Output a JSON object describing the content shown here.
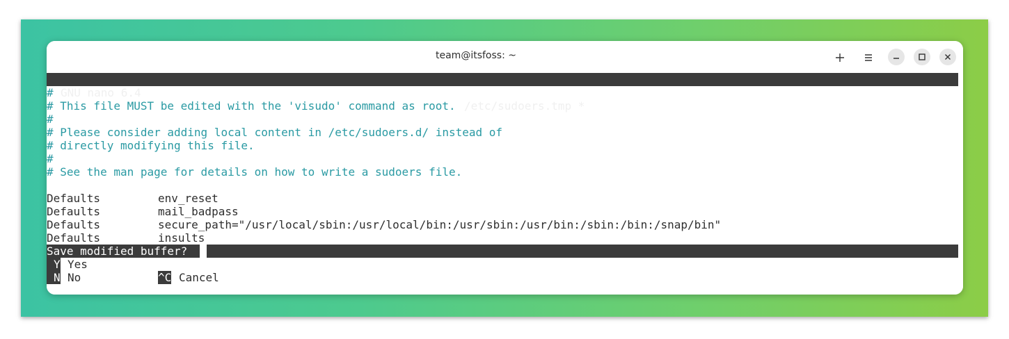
{
  "window": {
    "title": "team@itsfoss: ~",
    "new_tab_icon": "plus-icon",
    "menu_icon": "hamburger-icon",
    "minimize_icon": "minimize-icon",
    "maximize_icon": "maximize-icon",
    "close_icon": "close-icon"
  },
  "nano": {
    "version": "GNU nano 6.4",
    "filename": "/etc/sudoers.tmp *"
  },
  "lines": {
    "l1": "#",
    "l2": "# This file MUST be edited with the 'visudo' command as root.",
    "l3": "#",
    "l4": "# Please consider adding local content in /etc/sudoers.d/ instead of",
    "l5": "# directly modifying this file.",
    "l6": "#",
    "l7": "# See the man page for details on how to write a sudoers file.",
    "l8": "",
    "d1_key": "Defaults",
    "d1_val": "env_reset",
    "d2_key": "Defaults",
    "d2_val": "mail_badpass",
    "d3_key": "Defaults",
    "d3_val": "secure_path=\"/usr/local/sbin:/usr/local/bin:/usr/sbin:/usr/bin:/sbin:/bin:/snap/bin\"",
    "d4_key": "Defaults",
    "d4_val": "insults"
  },
  "prompt": {
    "question": "Save modified buffer?",
    "yes_key": "Y",
    "yes_label": "Yes",
    "no_key": "N",
    "no_label": "No",
    "cancel_key": "^C",
    "cancel_label": "Cancel"
  }
}
